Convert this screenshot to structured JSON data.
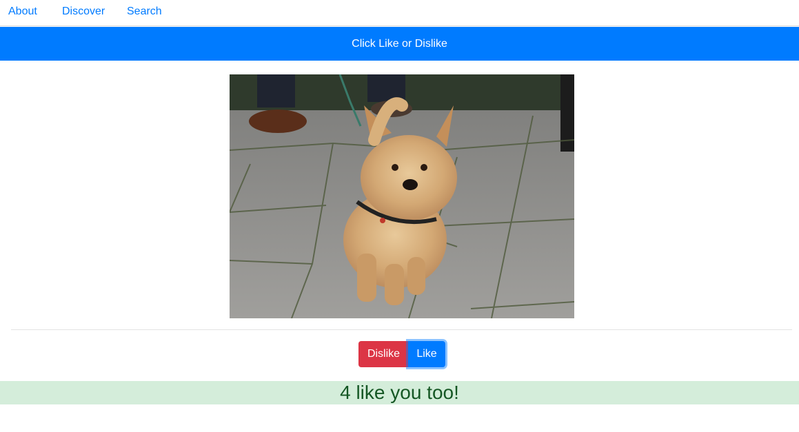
{
  "nav": {
    "items": [
      {
        "label": "About"
      },
      {
        "label": "Discover"
      },
      {
        "label": "Search"
      }
    ]
  },
  "banner": {
    "text": "Click Like or Dislike"
  },
  "photo": {
    "alt": "Small fluffy terrier dog on a leash standing on paving stones"
  },
  "actions": {
    "dislike_label": "Dislike",
    "like_label": "Like"
  },
  "result": {
    "message": "4 like you too!"
  },
  "colors": {
    "primary": "#007bff",
    "danger": "#dc3545",
    "success_bg": "#d4edda",
    "success_text": "#155724"
  }
}
